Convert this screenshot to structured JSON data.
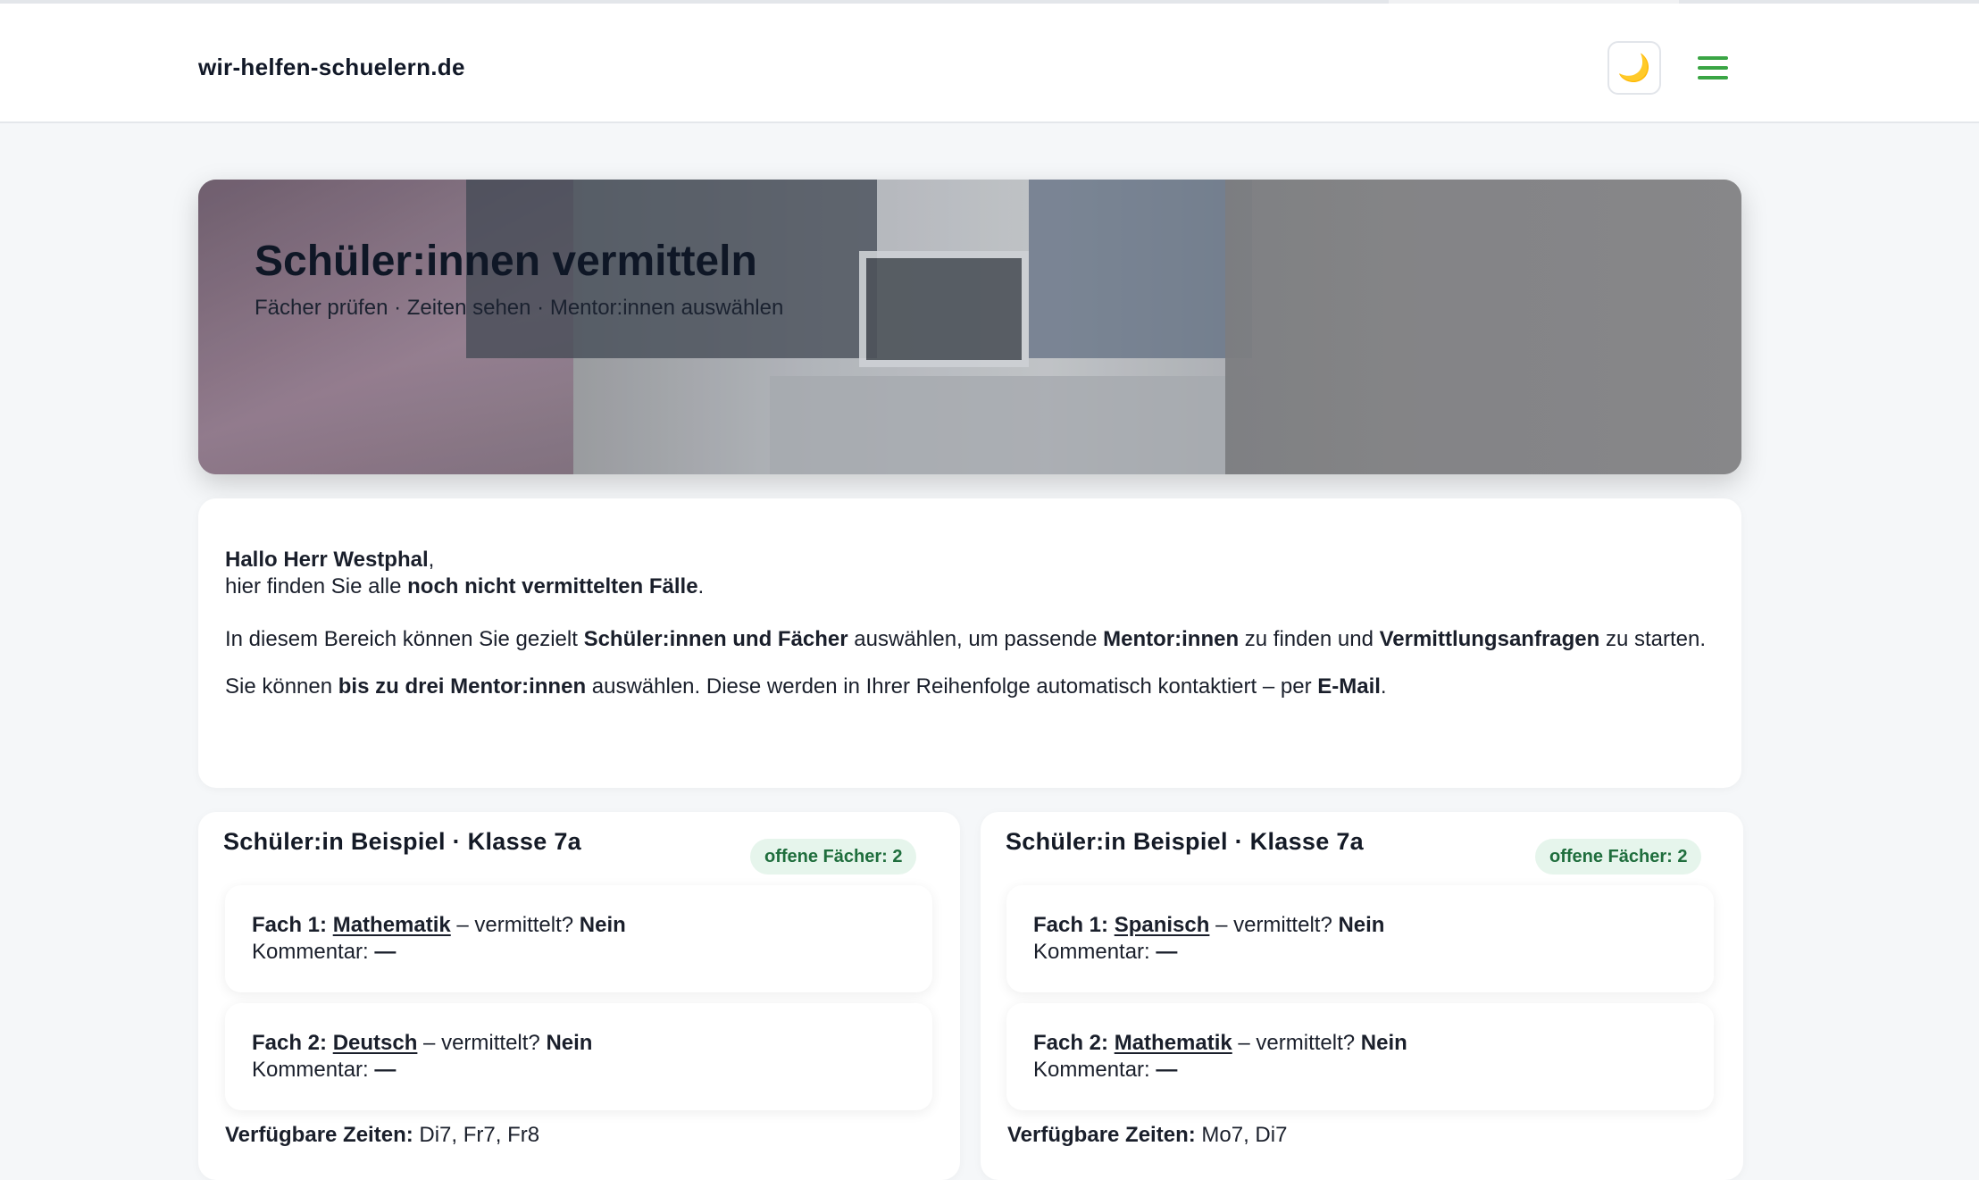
{
  "header": {
    "brand": "wir-helfen-schuelern.de",
    "theme_icon": "🌙",
    "menu_icon": "hamburger-menu-icon"
  },
  "hero": {
    "title": "Schüler:innen vermitteln",
    "subtitle": "Fächer prüfen · Zeiten sehen · Mentor:innen auswählen"
  },
  "intro": {
    "greeting_name": "Hallo Herr Westphal",
    "greeting_comma": ",",
    "line2_prefix": "hier finden Sie alle ",
    "line2_bold": "noch nicht vermittelten Fälle",
    "line2_suffix": ".",
    "p2_a": "In diesem Bereich können Sie gezielt ",
    "p2_b": "Schüler:innen und Fächer",
    "p2_c": " auswählen, um passende ",
    "p2_d": "Mentor:innen",
    "p2_e": " zu finden und ",
    "p2_f": "Vermittlungsanfragen",
    "p2_g": " zu starten.",
    "p3_a": "Sie können ",
    "p3_b": "bis zu drei Mentor:innen",
    "p3_c": " auswählen. Diese werden in Ihrer Reihenfolge automatisch kontaktiert – per ",
    "p3_d": "E-Mail",
    "p3_e": "."
  },
  "students": [
    {
      "title": "Schüler:in Beispiel · Klasse 7a",
      "badge": "offene Fächer: 2",
      "subjects": [
        {
          "label": "Fach 1:",
          "name": "Mathematik",
          "mid": " – vermittelt? ",
          "status": "Nein",
          "comment_label": "Kommentar: ",
          "comment": "—"
        },
        {
          "label": "Fach 2:",
          "name": "Deutsch",
          "mid": " – vermittelt? ",
          "status": "Nein",
          "comment_label": "Kommentar: ",
          "comment": "—"
        }
      ],
      "times_label": "Verfügbare Zeiten:",
      "times": " Di7, Fr7, Fr8"
    },
    {
      "title": "Schüler:in Beispiel · Klasse 7a",
      "badge": "offene Fächer: 2",
      "subjects": [
        {
          "label": "Fach 1:",
          "name": "Spanisch",
          "mid": " – vermittelt? ",
          "status": "Nein",
          "comment_label": "Kommentar: ",
          "comment": "—"
        },
        {
          "label": "Fach 2:",
          "name": "Mathematik",
          "mid": " – vermittelt? ",
          "status": "Nein",
          "comment_label": "Kommentar: ",
          "comment": "—"
        }
      ],
      "times_label": "Verfügbare Zeiten:",
      "times": " Mo7, Di7"
    }
  ],
  "colors": {
    "accent_green": "#3aa544",
    "badge_bg": "#e6f5ec",
    "badge_text": "#1f6e3d"
  }
}
